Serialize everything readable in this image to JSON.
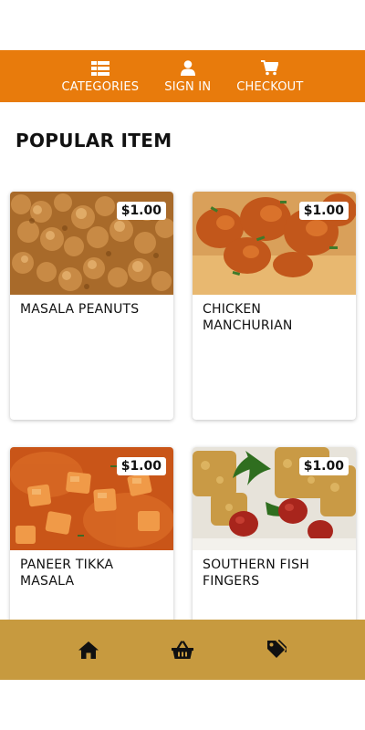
{
  "nav": {
    "items": [
      {
        "label": "CATEGORIES",
        "icon": "grid-list-icon"
      },
      {
        "label": "SIGN IN",
        "icon": "user-icon"
      },
      {
        "label": "CHECKOUT",
        "icon": "cart-icon"
      }
    ]
  },
  "section": {
    "title": "POPULAR ITEM"
  },
  "products": [
    {
      "name": "MASALA PEANUTS",
      "price": "$1.00"
    },
    {
      "name": "CHICKEN MANCHURIAN",
      "price": "$1.00"
    },
    {
      "name": "PANEER TIKKA MASALA",
      "price": "$1.00"
    },
    {
      "name": "SOUTHERN FISH FINGERS",
      "price": "$1.00"
    }
  ],
  "bottom_nav": {
    "items": [
      {
        "icon": "home-icon"
      },
      {
        "icon": "basket-icon"
      },
      {
        "icon": "tag-icon"
      }
    ]
  },
  "colors": {
    "nav_bg": "#e87b0c",
    "bottom_bg": "#c79a3f",
    "text": "#111111"
  }
}
